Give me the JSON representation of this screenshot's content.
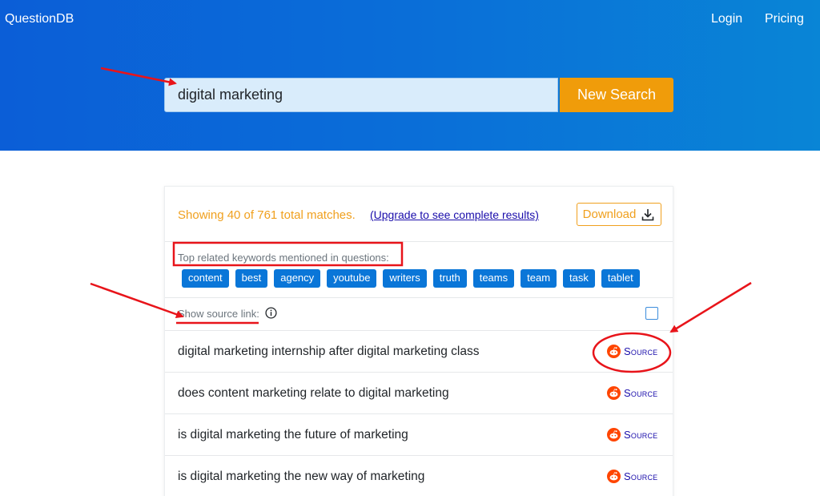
{
  "header": {
    "brand": "QuestionDB",
    "nav": {
      "login": "Login",
      "pricing": "Pricing"
    }
  },
  "search": {
    "value": "digital marketing",
    "button_label": "New Search"
  },
  "results": {
    "summary": "Showing 40 of 761 total matches.",
    "upgrade_link": "(Upgrade to see complete results)",
    "download_label": "Download",
    "keywords_label": "Top related keywords mentioned in questions:",
    "keywords": [
      "content",
      "best",
      "agency",
      "youtube",
      "writers",
      "truth",
      "teams",
      "team",
      "task",
      "tablet"
    ],
    "source_toggle_label": "Show source link:",
    "source_label": "Source",
    "questions": [
      "digital marketing internship after digital marketing class",
      "does content marketing relate to digital marketing",
      "is digital marketing the future of marketing",
      "is digital marketing the new way of marketing"
    ]
  },
  "colors": {
    "header_gradient_start": "#0b5ed7",
    "header_gradient_end": "#0985d6",
    "search_button": "#f09c0a",
    "chip": "#0a76d8",
    "accent_orange": "#f0a01e",
    "link": "#1a0dab",
    "annotation_red": "#e8141a"
  },
  "icons": {
    "download": "download-icon",
    "info": "info-circle-icon",
    "source": "reddit-icon"
  }
}
